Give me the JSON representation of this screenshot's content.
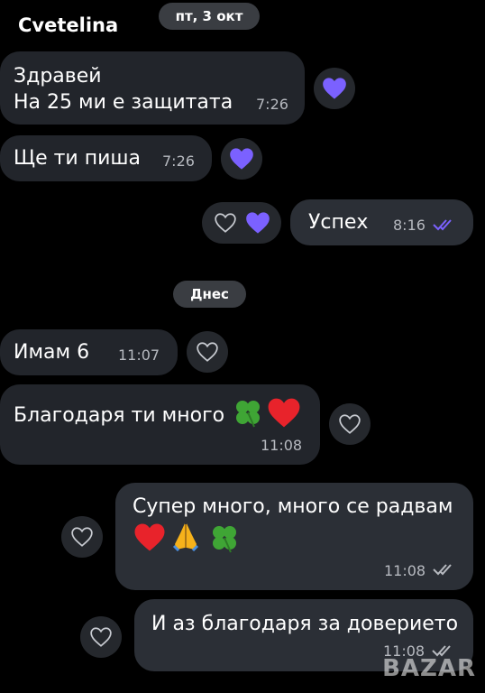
{
  "header": {
    "contact_name": "Cvetelina"
  },
  "dates": {
    "first": "пт, 3 окт",
    "today": "Днес"
  },
  "messages": {
    "m1": {
      "line1": "Здравей",
      "line2": "На 25 ми е защитата",
      "time": "7:26"
    },
    "m2": {
      "text": "Ще ти пиша",
      "time": "7:26"
    },
    "m3": {
      "text": "Успех",
      "time": "8:16"
    },
    "m4": {
      "text": "Имам 6",
      "time": "11:07"
    },
    "m5": {
      "text": "Благодаря ти много",
      "time": "11:08"
    },
    "m6": {
      "line1": "Супер много, много се радвам",
      "time": "11:08"
    },
    "m7": {
      "text": "И аз благодаря за доверието",
      "time": "11:08"
    }
  },
  "colors": {
    "background": "#000000",
    "bubble": "#22252b",
    "reaction_heart": "#7b61ff",
    "read_ticks_blue": "#7b61ff",
    "ticks_grey": "#b7bac0"
  },
  "icons": {
    "reaction_filled": "purple-heart-icon",
    "reaction_outline": "outline-heart-icon",
    "read_receipt": "double-check-icon",
    "emoji_clover": "four-leaf-clover-icon",
    "emoji_heart": "red-heart-icon",
    "emoji_pray": "folded-hands-icon"
  },
  "watermark": {
    "text": "BAZAR"
  }
}
